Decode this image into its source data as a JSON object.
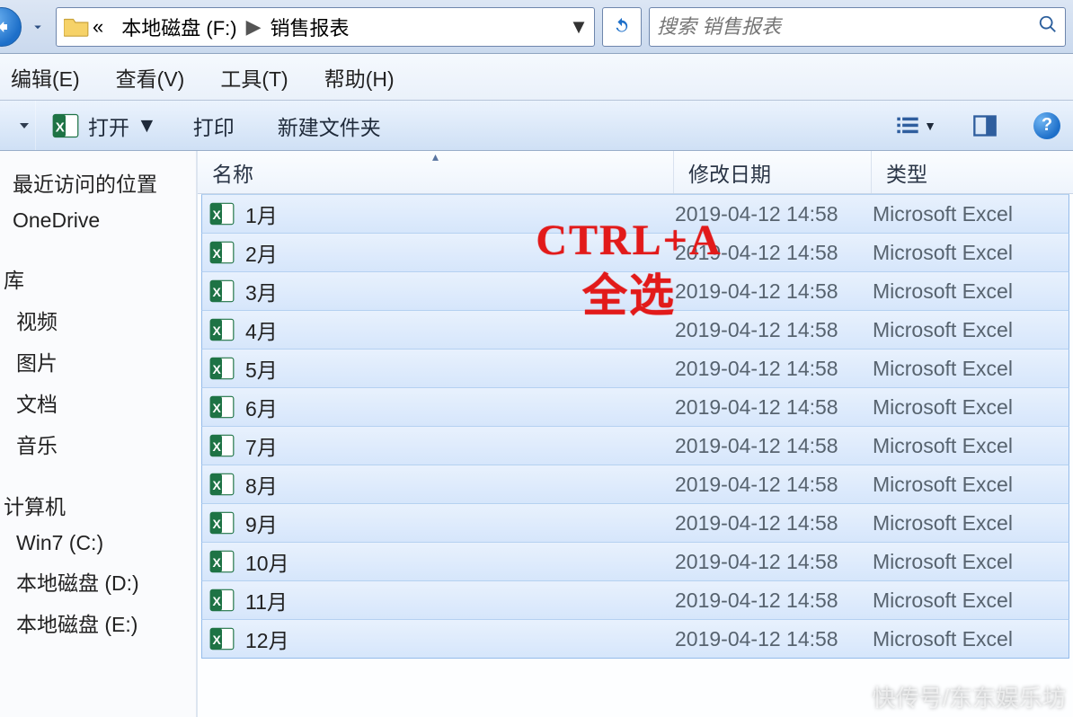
{
  "addressbar": {
    "sep_left": "«",
    "drive_label": "本地磁盘 (F:)",
    "arrow": "▶",
    "folder": "销售报表",
    "dropdown": "▼"
  },
  "search": {
    "placeholder": "搜索 销售报表"
  },
  "menubar": {
    "items": [
      "编辑(E)",
      "查看(V)",
      "工具(T)",
      "帮助(H)"
    ]
  },
  "toolbar": {
    "open_label": "打开",
    "print_label": "打印",
    "newfolder_label": "新建文件夹",
    "view_dropdown": "▼",
    "help_glyph": "?"
  },
  "navpane": {
    "recent": "最近访问的位置",
    "onedrive": "OneDrive",
    "lib_header": "库",
    "lib_items": [
      "视频",
      "图片",
      "文档",
      "音乐"
    ],
    "computer_header": "计算机",
    "drives": [
      "Win7 (C:)",
      "本地磁盘 (D:)",
      "本地磁盘 (E:)"
    ]
  },
  "columns": {
    "name": "名称",
    "date": "修改日期",
    "type": "类型",
    "sort_glyph": "▴"
  },
  "files": [
    {
      "name": "1月",
      "date": "2019-04-12 14:58",
      "type": "Microsoft Excel"
    },
    {
      "name": "2月",
      "date": "2019-04-12 14:58",
      "type": "Microsoft Excel"
    },
    {
      "name": "3月",
      "date": "2019-04-12 14:58",
      "type": "Microsoft Excel"
    },
    {
      "name": "4月",
      "date": "2019-04-12 14:58",
      "type": "Microsoft Excel"
    },
    {
      "name": "5月",
      "date": "2019-04-12 14:58",
      "type": "Microsoft Excel"
    },
    {
      "name": "6月",
      "date": "2019-04-12 14:58",
      "type": "Microsoft Excel"
    },
    {
      "name": "7月",
      "date": "2019-04-12 14:58",
      "type": "Microsoft Excel"
    },
    {
      "name": "8月",
      "date": "2019-04-12 14:58",
      "type": "Microsoft Excel"
    },
    {
      "name": "9月",
      "date": "2019-04-12 14:58",
      "type": "Microsoft Excel"
    },
    {
      "name": "10月",
      "date": "2019-04-12 14:58",
      "type": "Microsoft Excel"
    },
    {
      "name": "11月",
      "date": "2019-04-12 14:58",
      "type": "Microsoft Excel"
    },
    {
      "name": "12月",
      "date": "2019-04-12 14:58",
      "type": "Microsoft Excel"
    }
  ],
  "overlay": {
    "line1": "CTRL+A",
    "line2": "全选"
  },
  "watermark": "快传号/东东娱乐坊"
}
